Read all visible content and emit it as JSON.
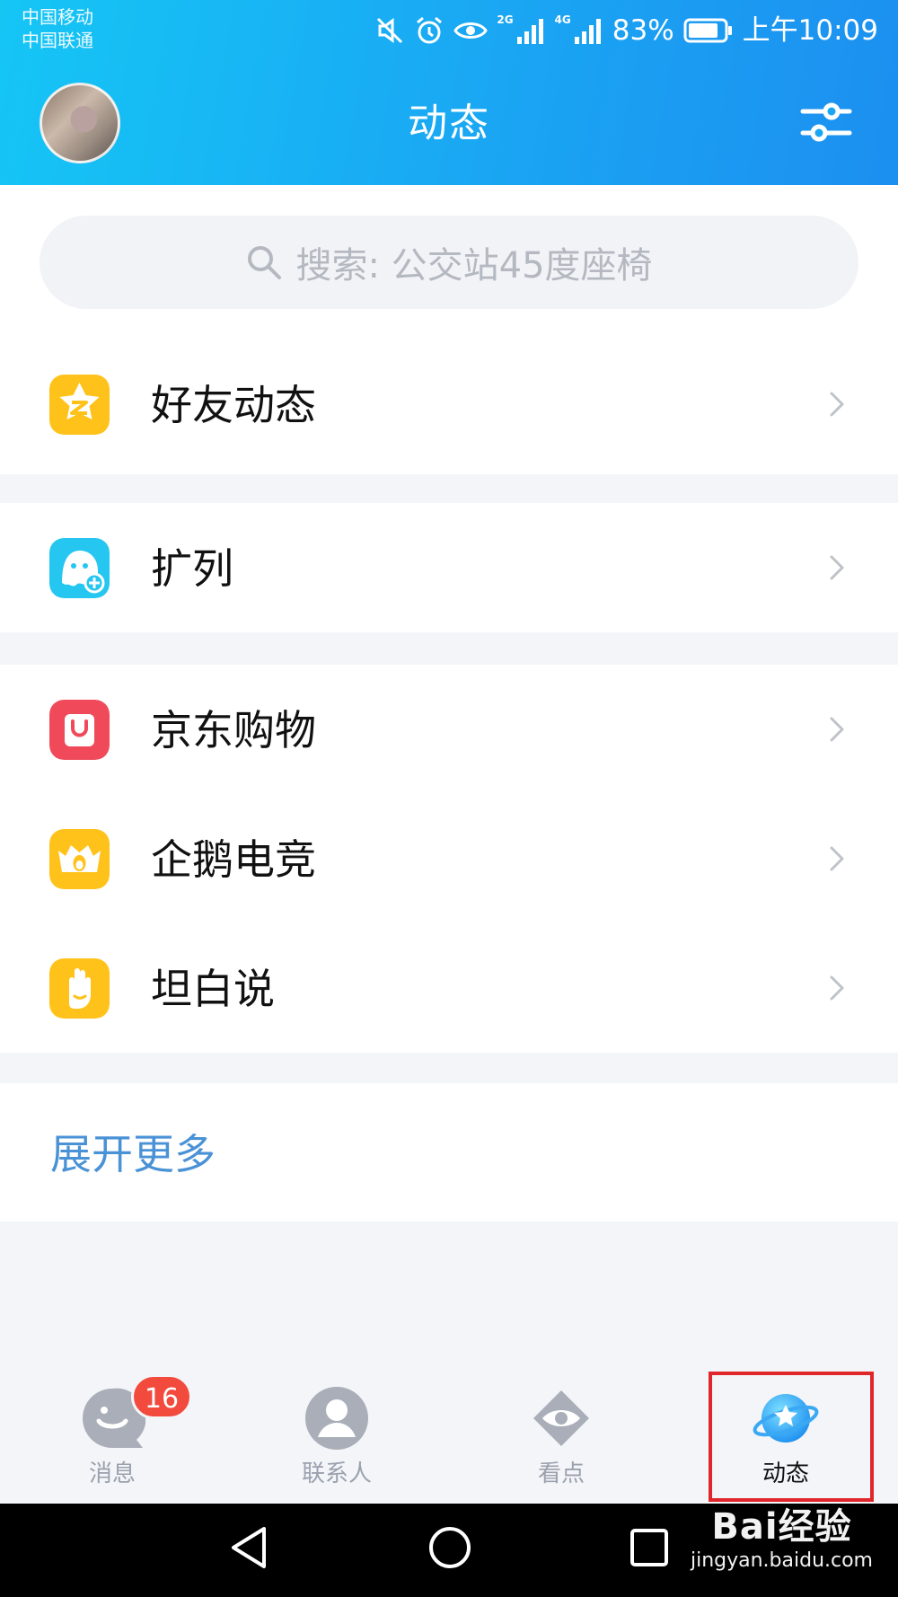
{
  "status_bar": {
    "carrier_1": "中国移动",
    "carrier_2": "中国联通",
    "network_1": "2G",
    "network_2": "4G",
    "battery": "83%",
    "time": "上午10:09"
  },
  "header": {
    "title": "动态"
  },
  "search": {
    "placeholder": "搜索: 公交站45度座椅"
  },
  "sections": [
    {
      "items": [
        {
          "label": "好友动态",
          "icon": "qzone-star-icon",
          "color": "#ffc21a"
        }
      ]
    },
    {
      "items": [
        {
          "label": "扩列",
          "icon": "ghost-add-friend-icon",
          "color": "#25c6f0"
        }
      ]
    },
    {
      "items": [
        {
          "label": "京东购物",
          "icon": "shopping-bag-icon",
          "color": "#f04a5a"
        },
        {
          "label": "企鹅电竞",
          "icon": "esports-crown-icon",
          "color": "#ffc21a"
        },
        {
          "label": "坦白说",
          "icon": "raised-hand-icon",
          "color": "#ffc21a"
        }
      ]
    }
  ],
  "expand_more": "展开更多",
  "tabbar": {
    "tabs": [
      {
        "label": "消息",
        "icon": "message-icon",
        "badge": "16"
      },
      {
        "label": "联系人",
        "icon": "contacts-icon"
      },
      {
        "label": "看点",
        "icon": "kandian-eye-icon"
      },
      {
        "label": "动态",
        "icon": "planet-star-icon",
        "active": true
      }
    ]
  },
  "watermark": {
    "main": "Bai经验",
    "sub": "jingyan.baidu.com"
  },
  "colors": {
    "header_start": "#15c6f5",
    "header_end": "#1c8ff0",
    "link": "#4a92d6",
    "badge": "#f24a3c",
    "highlight": "#e0262b"
  }
}
